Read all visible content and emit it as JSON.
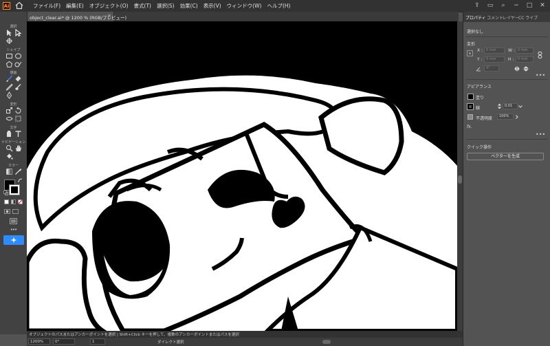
{
  "menubar": {
    "logo": "Ai",
    "menus": [
      "ファイル(F)",
      "編集(E)",
      "オブジェクト(O)",
      "書式(T)",
      "選択(S)",
      "効果(C)",
      "表示(V)",
      "ウィンドウ(W)",
      "ヘルプ(H)"
    ]
  },
  "document": {
    "tab_title": "object_clear.ai* @ 1200 % (RGB/プレビュー)",
    "close_glyph": "×"
  },
  "toolbar": {
    "sections": [
      "選択",
      "シェイプ",
      "描画",
      "変形",
      "文字",
      "ナビゲーション",
      "カラー"
    ],
    "more_glyph": "•••"
  },
  "panel": {
    "tabs": [
      "プロパティ",
      "コメント",
      "レイヤー",
      "CC ライブ"
    ],
    "no_selection": "選択なし",
    "transform_title": "変形",
    "x_label": "X :",
    "y_label": "Y :",
    "w_label": "W :",
    "h_label": "H :",
    "x_value": "0 mm",
    "y_value": "0 mm",
    "w_value": "0 mm",
    "h_value": "0 mm",
    "angle_value": "0°",
    "appearance_title": "アピアランス",
    "fill_label": "塗り",
    "stroke_label": "線",
    "stroke_value": "0.01",
    "opacity_label": "不透明度",
    "opacity_value": "100%",
    "fx_label": "fx.",
    "quick_actions_title": "クイック操作",
    "vectorize_button": "ベクターを生成",
    "more_glyph": "•••"
  },
  "status": {
    "message": "オブジェクトのパスまたはアンカーポイントを選択  |  Shift+Click キーを押して、複数のアンカーポイントまたはパスを選択",
    "zoom": "1200%",
    "rotation": "0°",
    "artboard": "1",
    "current_tool": "ダイレクト選択"
  },
  "colors": {
    "accent": "#2f8cff",
    "logo_orange": "#ff9a00",
    "canvas_black": "#000000"
  }
}
